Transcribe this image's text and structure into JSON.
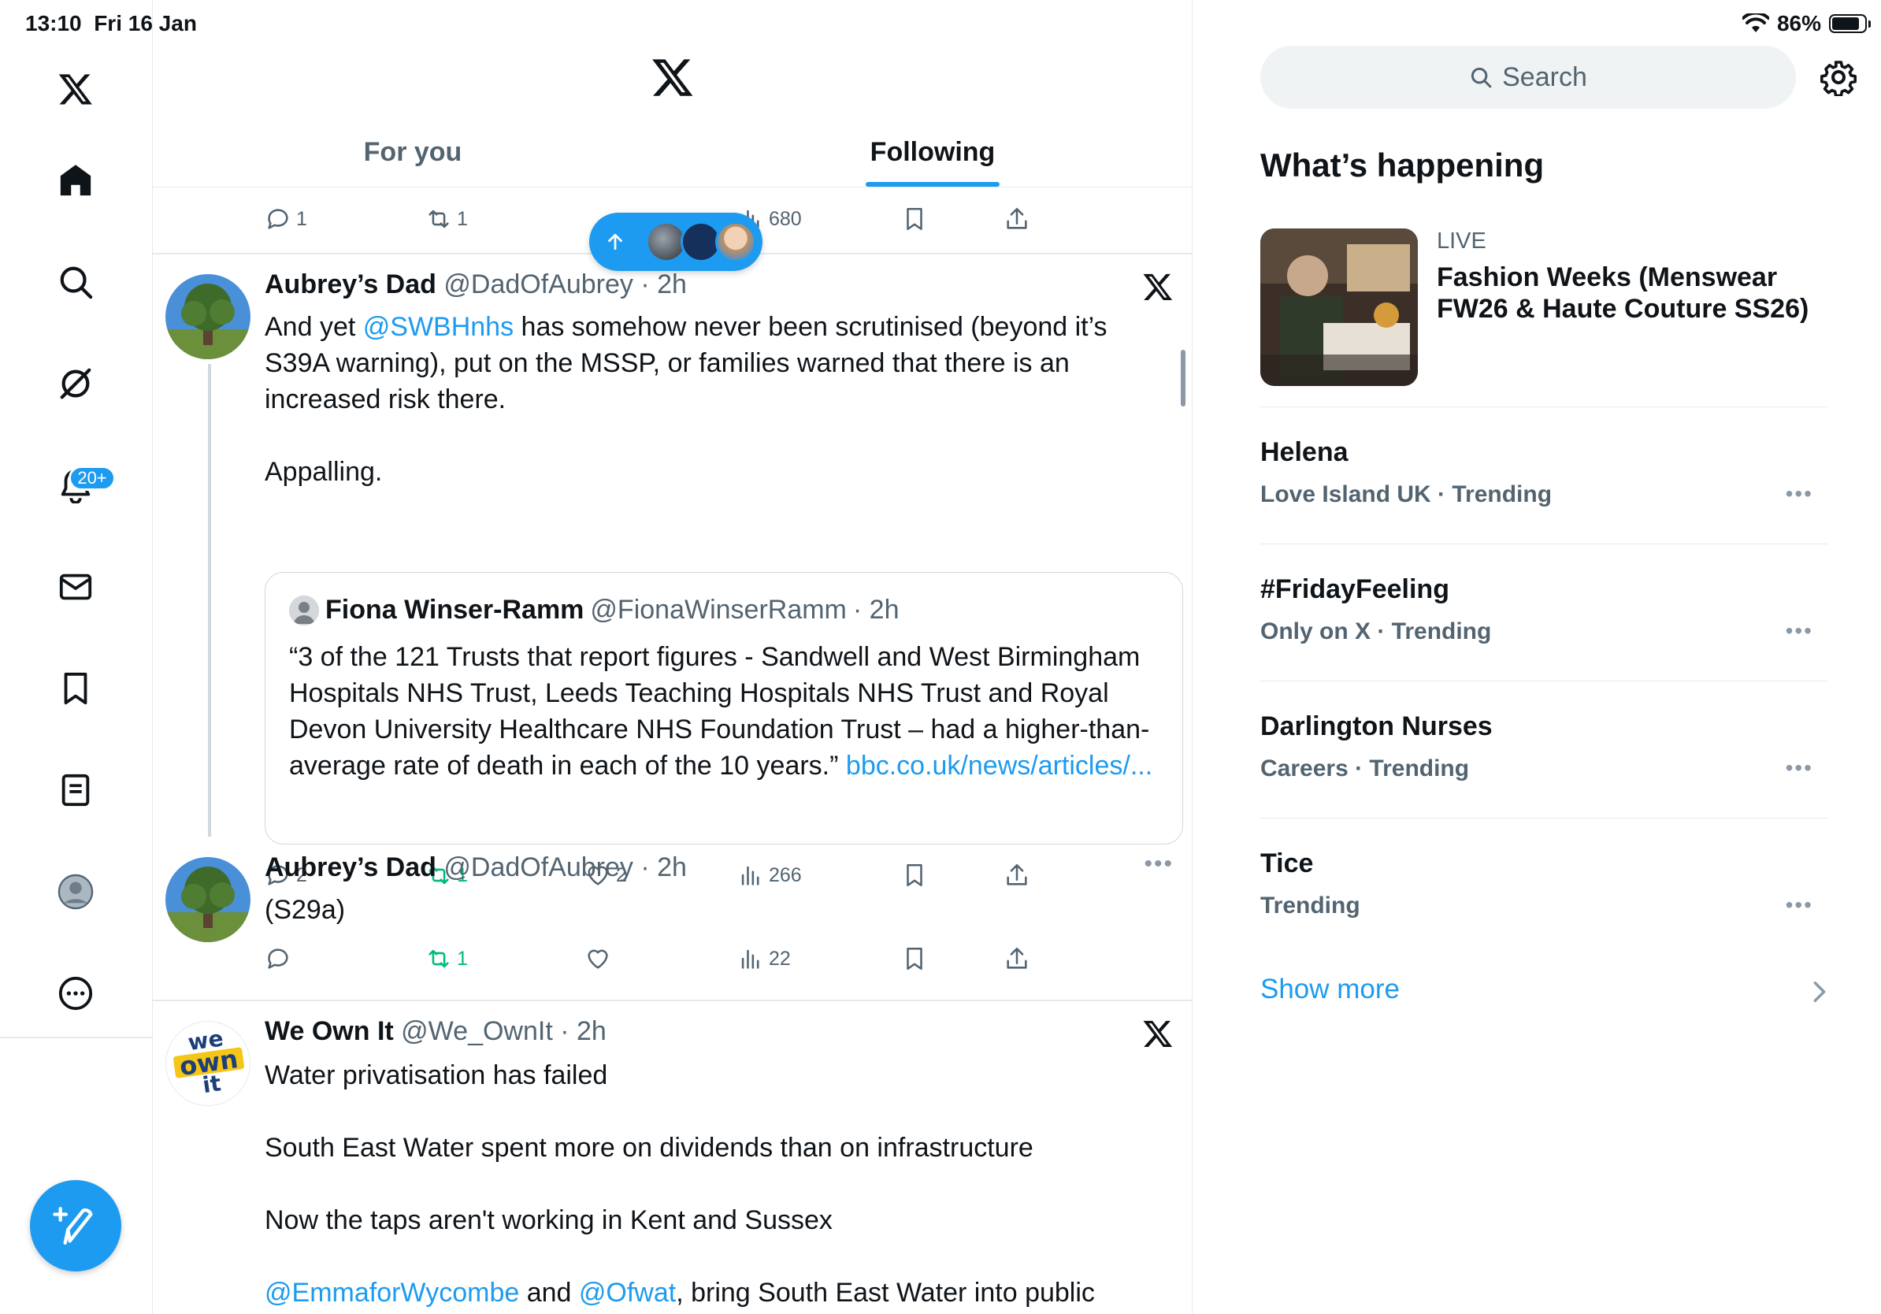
{
  "status": {
    "time": "13:10",
    "date": "Fri 16 Jan",
    "battery": "86%"
  },
  "nav": {
    "notifications_badge": "20+"
  },
  "tabs": [
    {
      "label": "For you"
    },
    {
      "label": "Following"
    }
  ],
  "prev_post": {
    "replies": "1",
    "reposts": "1",
    "views": "680"
  },
  "posts": [
    {
      "name": "Aubrey’s Dad",
      "handle": "@DadOfAubrey",
      "time": "· 2h",
      "text_prefix": "And yet ",
      "mention": "@SWBHnhs",
      "text_rest": " has somehow never been scrutinised (beyond it’s S39A warning), put on the MSSP, or families warned that there is an increased risk there.\n\nAppalling.",
      "quote": {
        "name": "Fiona Winser-Ramm",
        "handle": "@FionaWinserRamm",
        "time": "· 2h",
        "text": "“3 of the 121 Trusts that report figures - Sandwell and West Birmingham Hospitals NHS Trust, Leeds Teaching Hospitals NHS Trust and Royal Devon University Healthcare NHS Foundation Trust – had a higher-than-average rate of death in each of the 10 years.” ",
        "link": "bbc.co.uk/news/articles/..."
      },
      "replies": "2",
      "reposts": "1",
      "likes": "2",
      "views": "266"
    },
    {
      "name": "Aubrey’s Dad",
      "handle": "@DadOfAubrey",
      "time": "· 2h",
      "text": "(S29a)",
      "reposts": "1",
      "views": "22"
    },
    {
      "name": "We Own It",
      "handle": "@We_OwnIt",
      "time": "· 2h",
      "text": "Water privatisation has failed\n\nSouth East Water spent more on dividends than on infrastructure\n\nNow the taps aren't working in Kent and Sussex",
      "mention1": "@EmmaforWycombe",
      "and": " and ",
      "mention2": "@Ofwat",
      "text_end": ", bring South East Water into public",
      "avatar_text": {
        "l1": "we",
        "l2": "own",
        "l3": "it"
      }
    }
  ],
  "right": {
    "search_placeholder": "Search",
    "title": "What’s happening",
    "live": {
      "label": "LIVE",
      "title": "Fashion Weeks (Menswear FW26 & Haute Couture SS26)"
    },
    "trends": [
      {
        "name": "Helena",
        "meta": "Love Island UK · Trending"
      },
      {
        "name": "#FridayFeeling",
        "meta": "Only on X · Trending"
      },
      {
        "name": "Darlington Nurses",
        "meta": "Careers · Trending"
      },
      {
        "name": "Tice",
        "meta": "Trending"
      }
    ],
    "show_more": "Show more"
  }
}
